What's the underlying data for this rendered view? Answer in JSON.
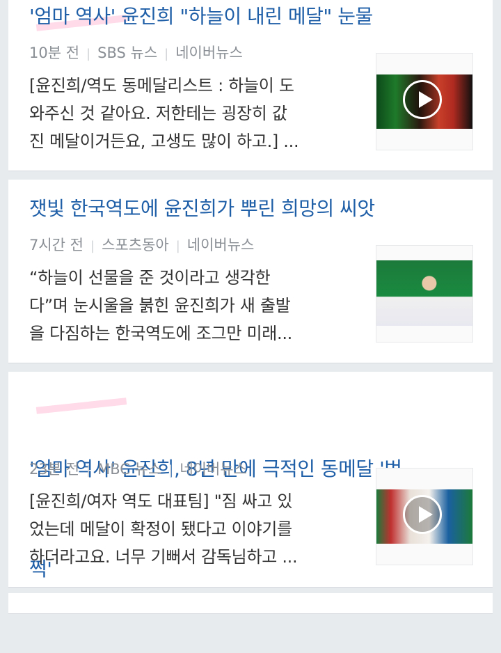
{
  "items": [
    {
      "title": "'엄마 역사' 윤진희 \"하늘이 내린 메달\" 눈물",
      "time": "10분 전",
      "source": "SBS 뉴스",
      "platform": "네이버뉴스",
      "body_line1": "[윤진희/역도 동메달리스트 : 하늘이 도",
      "body_line2": "와주신 것 같아요. 저한테는 굉장히 값",
      "body_line3": "진 메달이거든요, 고생도 많이 하고.] ...",
      "thumbnail": "weightlifting-video-thumbnail",
      "has_video": true
    },
    {
      "title": "잿빛 한국역도에 윤진희가 뿌린 희망의 씨앗",
      "time": "7시간 전",
      "source": "스포츠동아",
      "platform": "네이버뉴스",
      "body_line1": "“하늘이 선물을 준 것이라고 생각한",
      "body_line2": "다”며 눈시울을 붉힌 윤진희가 새 출발",
      "body_line3": "을 다짐하는 한국역도에 조그만 미래...",
      "thumbnail": "medalist-photo-thumbnail",
      "has_video": false
    },
    {
      "title_line1": "'엄마 역사' 윤진희, 8년 만에 극적인 동메달 '번",
      "title_line2": "쩍'",
      "time": "23분 전",
      "source": "MBC 뉴스",
      "platform": "네이버뉴스",
      "body_line1": "[윤진희/여자 역도 대표팀] \"짐 싸고 있",
      "body_line2": "었는데 메달이 확정이 됐다고 이야기를",
      "body_line3": "하더라고요. 너무 기뻐서 감독님하고 ...",
      "thumbnail": "podium-video-thumbnail",
      "has_video": true
    }
  ],
  "colors": {
    "title": "#1f5fa8",
    "meta": "#8a8f95",
    "background": "#e8ebee"
  }
}
